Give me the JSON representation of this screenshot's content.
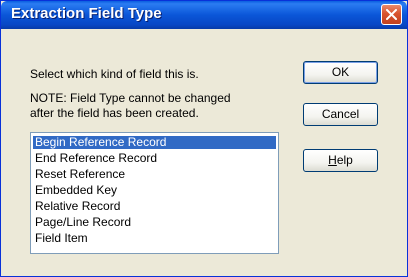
{
  "window": {
    "title": "Extraction Field Type"
  },
  "content": {
    "instruction": "Select which kind of field this is.",
    "note_line1": "NOTE:  Field Type cannot be changed",
    "note_line2": "after the field has been created."
  },
  "field_types": [
    "Begin Reference Record",
    "End Reference Record",
    "Reset Reference",
    "Embedded Key",
    "Relative Record",
    "Page/Line Record",
    "Field Item"
  ],
  "selected_index": 0,
  "buttons": {
    "ok": "OK",
    "cancel": "Cancel",
    "help_underlined": "H",
    "help_rest": "elp"
  },
  "colors": {
    "title_bar": "#0a56d8",
    "selection": "#316ac5",
    "close_button": "#d9532e",
    "dialog_background": "#ece9d8"
  },
  "icons": {
    "close": "close-icon"
  }
}
